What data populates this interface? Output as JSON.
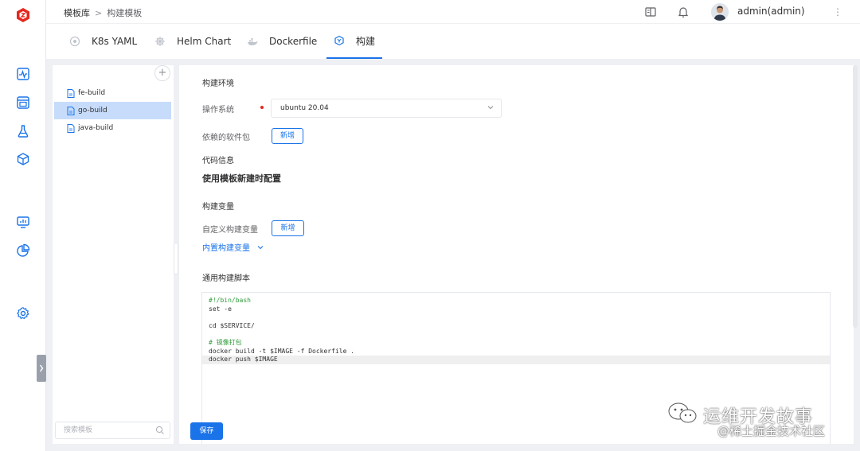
{
  "header": {
    "breadcrumb": [
      "模板库",
      "构建模板"
    ],
    "breadcrumb_sep": ">",
    "user": "admin(admin)",
    "more_glyph": "⋮"
  },
  "tabs": [
    {
      "label": "K8s YAML",
      "icon": "k8s-icon"
    },
    {
      "label": "Helm Chart",
      "icon": "helm-icon"
    },
    {
      "label": "Dockerfile",
      "icon": "docker-icon"
    },
    {
      "label": "构建",
      "icon": "build-icon",
      "active": true
    }
  ],
  "templates": {
    "add_glyph": "+",
    "items": [
      "fe-build",
      "go-build",
      "java-build"
    ],
    "selected": "go-build",
    "search_placeholder": "搜索模板"
  },
  "form": {
    "section_env": "构建环境",
    "os_label": "操作系统",
    "os_value": "ubuntu 20.04",
    "deps_label": "依赖的软件包",
    "deps_add": "新增",
    "section_code": "代码信息",
    "code_note": "使用模板新建时配置",
    "section_vars": "构建变量",
    "custom_vars_label": "自定义构建变量",
    "custom_vars_add": "新增",
    "builtin_vars": "内置构建变量",
    "section_script": "通用构建脚本",
    "script_lines": [
      "#!/bin/bash",
      "set -e",
      "",
      "cd $SERVICE/",
      "",
      "# 镜像打包",
      "docker build -t $IMAGE -f Dockerfile .",
      "docker push $IMAGE"
    ],
    "save": "保存"
  },
  "watermark": {
    "line1": "运维开发故事",
    "line2": "@稀土掘金技术社区"
  },
  "colors": {
    "accent": "#1a73e8",
    "brand": "#e5271f",
    "selected_row": "#c6dcfa",
    "comment": "#2e9b3a"
  }
}
